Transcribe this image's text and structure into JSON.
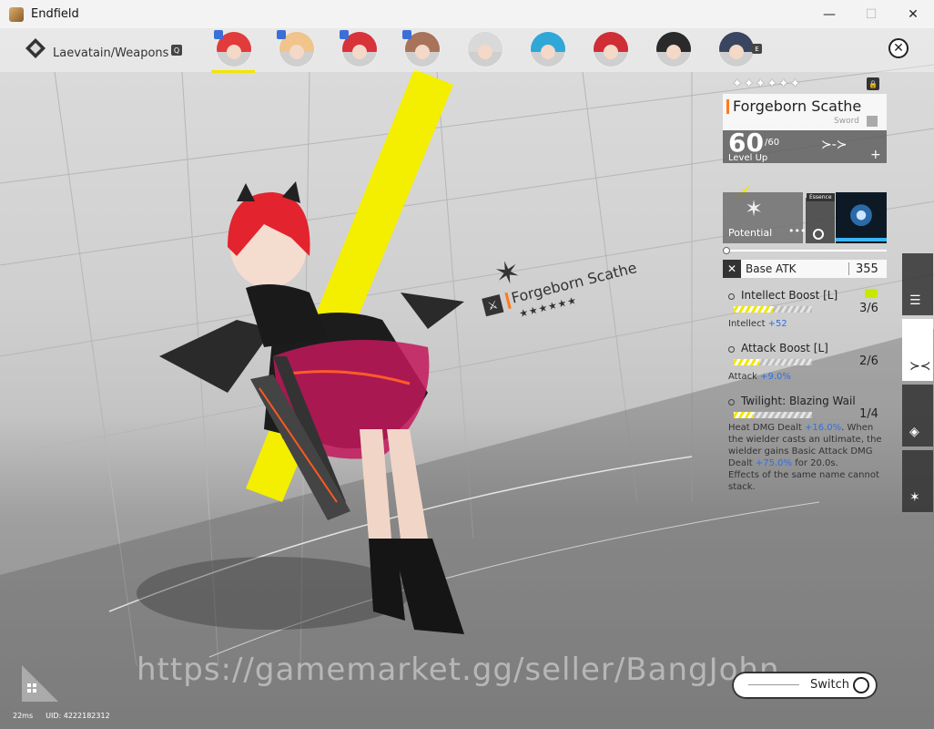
{
  "window": {
    "title": "Endfield",
    "buttons": {
      "minimize": "—",
      "maximize": "☐",
      "close": "✕"
    }
  },
  "breadcrumb": {
    "text": "Laevatain/Weapons",
    "key_hint": "Q"
  },
  "party": {
    "avatars": [
      {
        "hair": "#e23b3b",
        "badge": true,
        "selected": true
      },
      {
        "hair": "#f0c48a",
        "badge": true,
        "selected": false
      },
      {
        "hair": "#d8323b",
        "badge": true,
        "selected": false
      },
      {
        "hair": "#a8735a",
        "badge": true,
        "selected": false
      },
      {
        "hair": "#d9d9d9",
        "badge": false,
        "selected": false
      },
      {
        "hair": "#2fa8d8",
        "badge": false,
        "selected": false
      },
      {
        "hair": "#cf2e35",
        "badge": false,
        "selected": false
      },
      {
        "hair": "#2a2a2a",
        "badge": false,
        "selected": false
      },
      {
        "hair": "#3a4660",
        "badge": false,
        "selected": false
      }
    ],
    "next_key": "E"
  },
  "stage_label": {
    "weapon_name": "Forgeborn Scathe",
    "stars": "★★★★★★"
  },
  "weapon": {
    "rarity_stars": "✦✦✦✦✦✦",
    "name": "Forgeborn Scathe",
    "type": "Sword",
    "level": "60",
    "level_max": "/60",
    "level_up_label": "Level Up",
    "potential_label": "Potential",
    "potential_more": "•••",
    "essence_tag": "Essence",
    "base_stat": {
      "label": "Base ATK",
      "value": "355"
    },
    "skills": [
      {
        "name": "Intellect Boost [L]",
        "count": "3/6",
        "fill": 0.5,
        "effect_prefix": "Intellect ",
        "effect_value": "+52"
      },
      {
        "name": "Attack Boost [L]",
        "count": "2/6",
        "fill": 0.33,
        "effect_prefix": "Attack ",
        "effect_value": "+9.0%"
      },
      {
        "name": "Twilight: Blazing Wail",
        "count": "1/4",
        "fill": 0.25,
        "desc_1": "Heat DMG Dealt ",
        "desc_1_value": "+16.0%",
        "desc_2": ". When the wielder casts an ultimate, the wielder gains Basic Attack DMG Dealt ",
        "desc_2_value": "+75.0%",
        "desc_3": " for 20.0s.",
        "desc_4": "Effects of the same name cannot stack."
      }
    ]
  },
  "switch": {
    "label": "Switch"
  },
  "watermark": "https://gamemarket.gg/seller/BangJohn",
  "status": {
    "ping": "22ms",
    "uid": "UID: 4222182312"
  },
  "colors": {
    "accent_yellow": "#f2e600",
    "accent_orange": "#ff7a1a",
    "value_blue": "#2f6fe4"
  }
}
